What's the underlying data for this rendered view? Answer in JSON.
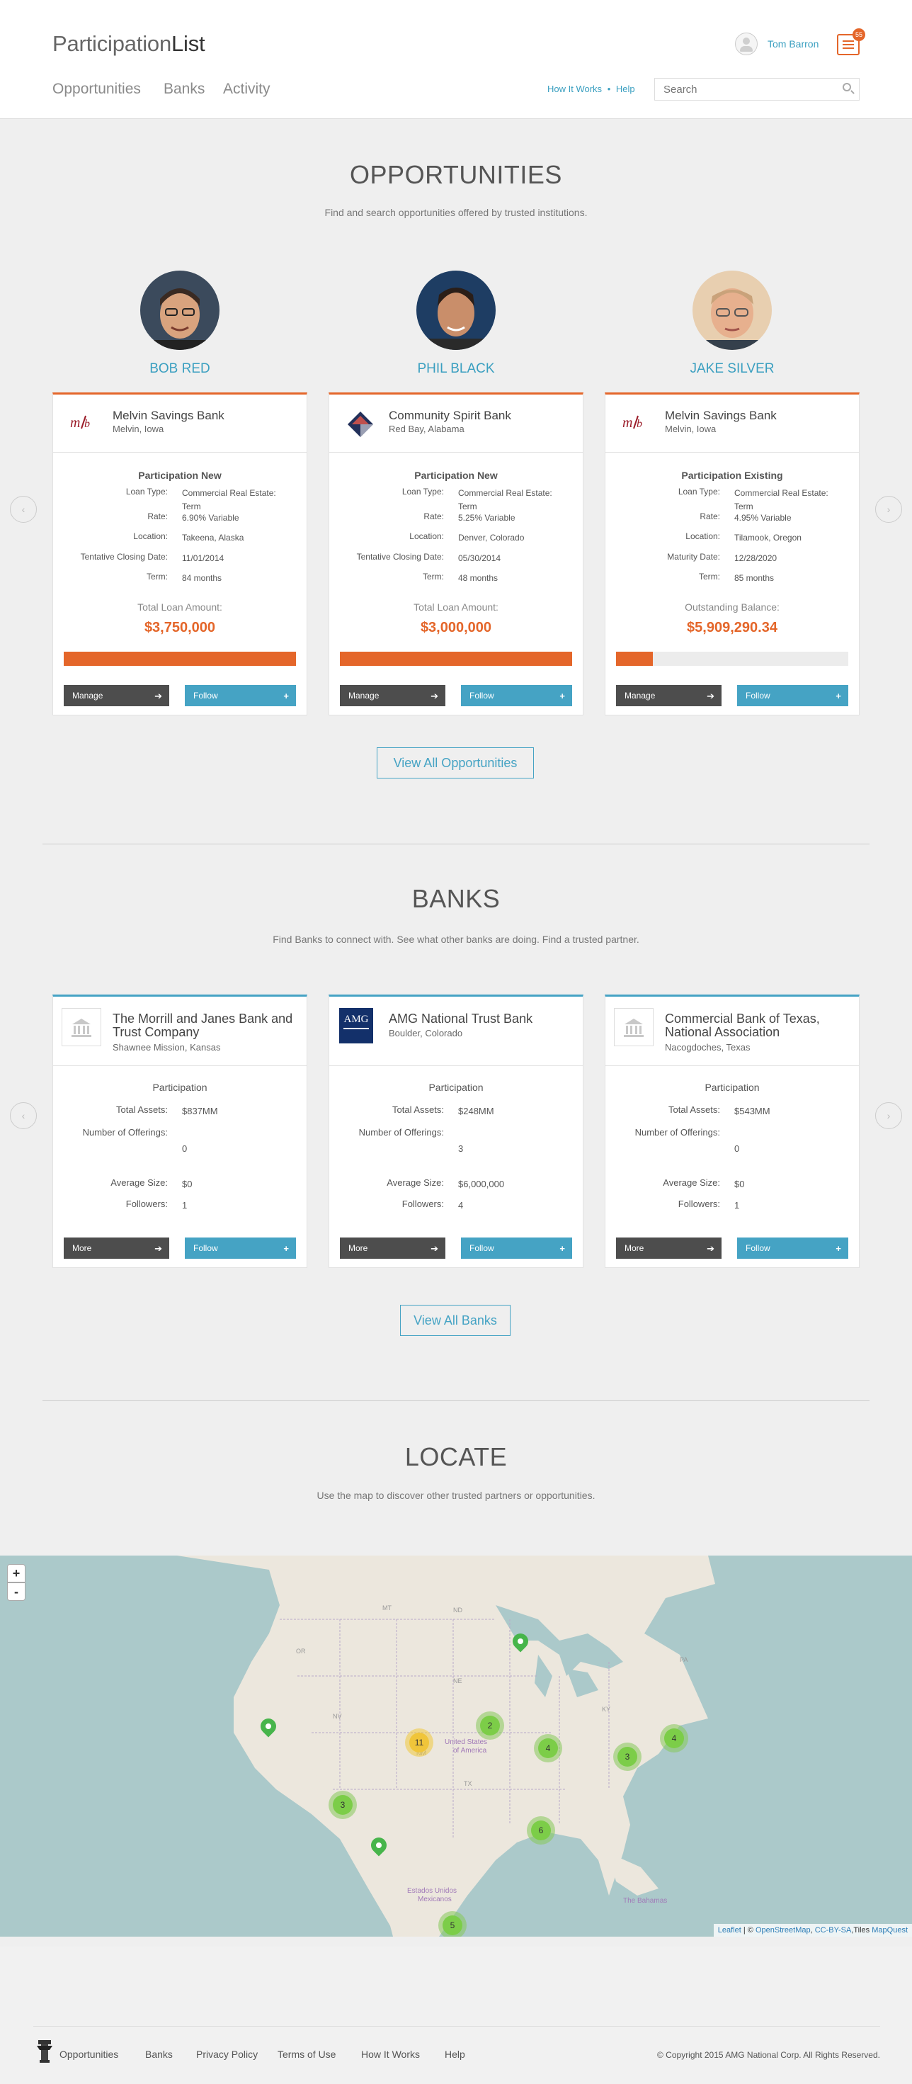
{
  "header": {
    "logo_light": "Participation",
    "logo_bold": "List",
    "nav": [
      "Opportunities",
      "Banks",
      "Activity"
    ],
    "user_name": "Tom Barron",
    "notification_count": "55",
    "how_it_works": "How It Works",
    "help": "Help",
    "search_placeholder": "Search"
  },
  "opportunities": {
    "title": "OPPORTUNITIES",
    "subtitle": "Find and search opportunities offered by trusted institutions.",
    "people": [
      "BOB RED",
      "PHIL BLACK",
      "JAKE SILVER"
    ],
    "cards": [
      {
        "bank": "Melvin Savings Bank",
        "location": "Melvin, Iowa",
        "participation": "Participation New",
        "rows": [
          [
            "Loan Type:",
            "Commercial Real Estate: Term"
          ],
          [
            "Rate:",
            "6.90% Variable"
          ],
          [
            "Location:",
            "Takeena, Alaska"
          ],
          [
            "Tentative Closing Date:",
            "11/01/2014"
          ],
          [
            "Term:",
            "84 months"
          ]
        ],
        "amount_label": "Total Loan Amount:",
        "amount": "$3,750,000",
        "progress": 1.0,
        "btn1": "Manage",
        "btn2": "Follow"
      },
      {
        "bank": "Community Spirit Bank",
        "location": "Red Bay, Alabama",
        "participation": "Participation New",
        "rows": [
          [
            "Loan Type:",
            "Commercial Real Estate: Term"
          ],
          [
            "Rate:",
            "5.25% Variable"
          ],
          [
            "Location:",
            "Denver, Colorado"
          ],
          [
            "Tentative Closing Date:",
            "05/30/2014"
          ],
          [
            "Term:",
            "48 months"
          ]
        ],
        "amount_label": "Total Loan Amount:",
        "amount": "$3,000,000",
        "progress": 1.0,
        "btn1": "Manage",
        "btn2": "Follow"
      },
      {
        "bank": "Melvin Savings Bank",
        "location": "Melvin, Iowa",
        "participation": "Participation Existing",
        "rows": [
          [
            "Loan Type:",
            "Commercial Real Estate: Term"
          ],
          [
            "Rate:",
            "4.95% Variable"
          ],
          [
            "Location:",
            "Tilamook, Oregon"
          ],
          [
            "Maturity Date:",
            "12/28/2020"
          ],
          [
            "Term:",
            "85 months"
          ]
        ],
        "amount_label": "Outstanding Balance:",
        "amount": "$5,909,290.34",
        "progress": 0.16,
        "btn1": "Manage",
        "btn2": "Follow"
      }
    ],
    "view_all": "View All Opportunities"
  },
  "banks": {
    "title": "BANKS",
    "subtitle": "Find Banks to connect with. See what other banks are doing. Find a trusted partner.",
    "cards": [
      {
        "name": "The Morrill and Janes Bank and Trust Company",
        "location": "Shawnee Mission, Kansas",
        "participation": "Participation",
        "total_assets_label": "Total Assets:",
        "total_assets": "$837MM",
        "offerings_label": "Number of Offerings:",
        "offerings": "0",
        "avg_label": "Average Size:",
        "avg": "$0",
        "followers_label": "Followers:",
        "followers": "1",
        "btn1": "More",
        "btn2": "Follow"
      },
      {
        "name": "AMG National Trust Bank",
        "location": "Boulder, Colorado",
        "participation": "Participation",
        "total_assets_label": "Total Assets:",
        "total_assets": "$248MM",
        "offerings_label": "Number of Offerings:",
        "offerings": "3",
        "avg_label": "Average Size:",
        "avg": "$6,000,000",
        "followers_label": "Followers:",
        "followers": "4",
        "btn1": "More",
        "btn2": "Follow"
      },
      {
        "name": "Commercial Bank of Texas, National Association",
        "location": "Nacogdoches, Texas",
        "participation": "Participation",
        "total_assets_label": "Total Assets:",
        "total_assets": "$543MM",
        "offerings_label": "Number of Offerings:",
        "offerings": "0",
        "avg_label": "Average Size:",
        "avg": "$0",
        "followers_label": "Followers:",
        "followers": "1",
        "btn1": "More",
        "btn2": "Follow"
      }
    ],
    "amg_logo_text": "AMG",
    "view_all": "View All Banks"
  },
  "locate": {
    "title": "LOCATE",
    "subtitle": "Use the map to discover other trusted partners or opportunities.",
    "zoom_in": "+",
    "zoom_out": "-",
    "clusters": [
      "11",
      "2",
      "4",
      "3",
      "4",
      "3",
      "6",
      "5"
    ],
    "attribution": {
      "leaflet": "Leaflet",
      "sep": " | © ",
      "osm": "OpenStreetMap",
      "license": "CC-BY-SA",
      "tiles": "Tiles",
      "mq": "MapQuest"
    }
  },
  "footer": {
    "links": [
      "Opportunities",
      "Banks",
      "Privacy Policy",
      "Terms of Use",
      "How It Works",
      "Help"
    ],
    "copyright": "© Copyright 2015 AMG National Corp. All Rights Reserved."
  },
  "colors": {
    "accent": "#e4662a",
    "link": "#3a9fc0",
    "button_blue": "#45a3c4",
    "button_dark": "#4d4d4d"
  }
}
